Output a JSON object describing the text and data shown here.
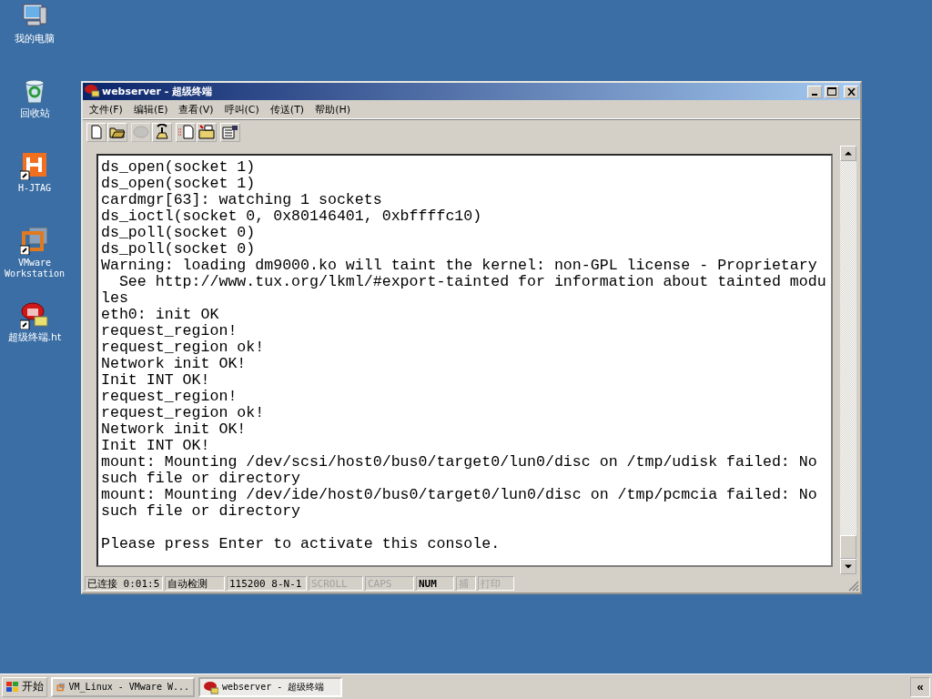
{
  "desktop_icons": [
    {
      "label": "我的电脑",
      "kind": "computer"
    },
    {
      "label": "回收站",
      "kind": "recycle"
    },
    {
      "label": "H-JTAG",
      "kind": "hjtag"
    },
    {
      "label": "VMware Workstation",
      "kind": "vmware"
    },
    {
      "label": "超级终端.ht",
      "kind": "phone"
    }
  ],
  "window": {
    "title": "webserver - 超级终端",
    "menu": [
      "文件(F)",
      "编辑(E)",
      "查看(V)",
      "呼叫(C)",
      "传送(T)",
      "帮助(H)"
    ],
    "toolbar": [
      {
        "kind": "new",
        "disabled": false
      },
      {
        "kind": "open",
        "disabled": false
      },
      {
        "kind": "disconnect",
        "disabled": true
      },
      {
        "kind": "dial",
        "disabled": false
      },
      {
        "kind": "send",
        "disabled": false
      },
      {
        "kind": "receive",
        "disabled": false
      },
      {
        "kind": "properties",
        "disabled": false
      }
    ],
    "terminal": {
      "lines": [
        "ds_open(socket 1)",
        "ds_open(socket 1)",
        "cardmgr[63]: watching 1 sockets",
        "ds_ioctl(socket 0, 0x80146401, 0xbffffc10)",
        "ds_poll(socket 0)",
        "ds_poll(socket 0)",
        "Warning: loading dm9000.ko will taint the kernel: non-GPL license - Proprietary",
        "  See http://www.tux.org/lkml/#export-tainted for information about tainted modu",
        "les",
        "eth0: init OK",
        "request_region!",
        "request_region ok!",
        "Network init OK!",
        "Init INT OK!",
        "request_region!",
        "request_region ok!",
        "Network init OK!",
        "Init INT OK!",
        "mount: Mounting /dev/scsi/host0/bus0/target0/lun0/disc on /tmp/udisk failed: No",
        "such file or directory",
        "mount: Mounting /dev/ide/host0/bus0/target0/lun0/disc on /tmp/pcmcia failed: No",
        "such file or directory"
      ],
      "prompt": "Please press Enter to activate this console."
    },
    "status_bar": [
      {
        "text": "已连接 0:01:5",
        "on": true
      },
      {
        "text": "自动检测",
        "on": true
      },
      {
        "text": "115200 8-N-1",
        "on": true
      },
      {
        "text": "SCROLL",
        "on": false
      },
      {
        "text": "CAPS",
        "on": false
      },
      {
        "text": "NUM",
        "on": true
      },
      {
        "text": "捕",
        "on": false
      },
      {
        "text": "打印",
        "on": false
      }
    ]
  },
  "taskbar": {
    "start": "开始",
    "tasks": [
      {
        "label": "VM_Linux - VMware W...",
        "kind": "vmware",
        "selected": false
      },
      {
        "label": "webserver - 超级终端",
        "kind": "phone",
        "selected": true
      }
    ],
    "tray_button": "«"
  }
}
